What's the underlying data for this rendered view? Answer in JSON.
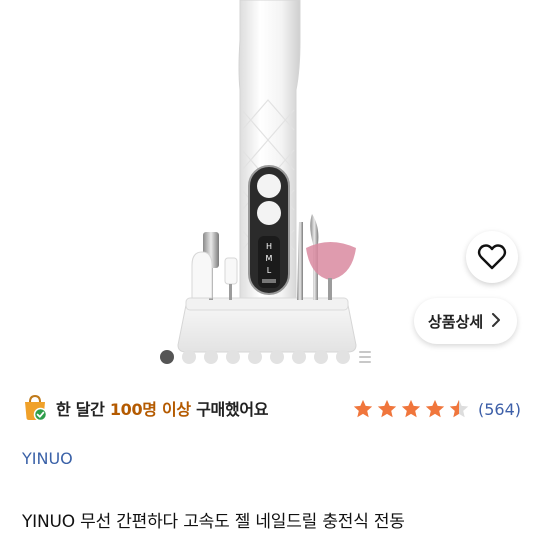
{
  "gallery": {
    "page_count": 9,
    "current_index": 0,
    "device_labels": [
      "H",
      "M",
      "L"
    ]
  },
  "wishlist": {
    "icon": "heart-outline-icon"
  },
  "detail_button": {
    "label": "상품상세",
    "icon": "chevron-right-icon"
  },
  "purchase": {
    "icon": "shopping-bag-check-icon",
    "prefix": "한 달간 ",
    "highlight": "100명 이상",
    "suffix": " 구매했어요",
    "highlight_color": "#b45a00"
  },
  "rating": {
    "value": 4.5,
    "max": 5,
    "star_color": "#f0763c",
    "review_count": "(564)"
  },
  "brand": "YINUO",
  "title": "YINUO 무선 간편하다 고속도 젤 네일드릴 충전식 전동"
}
